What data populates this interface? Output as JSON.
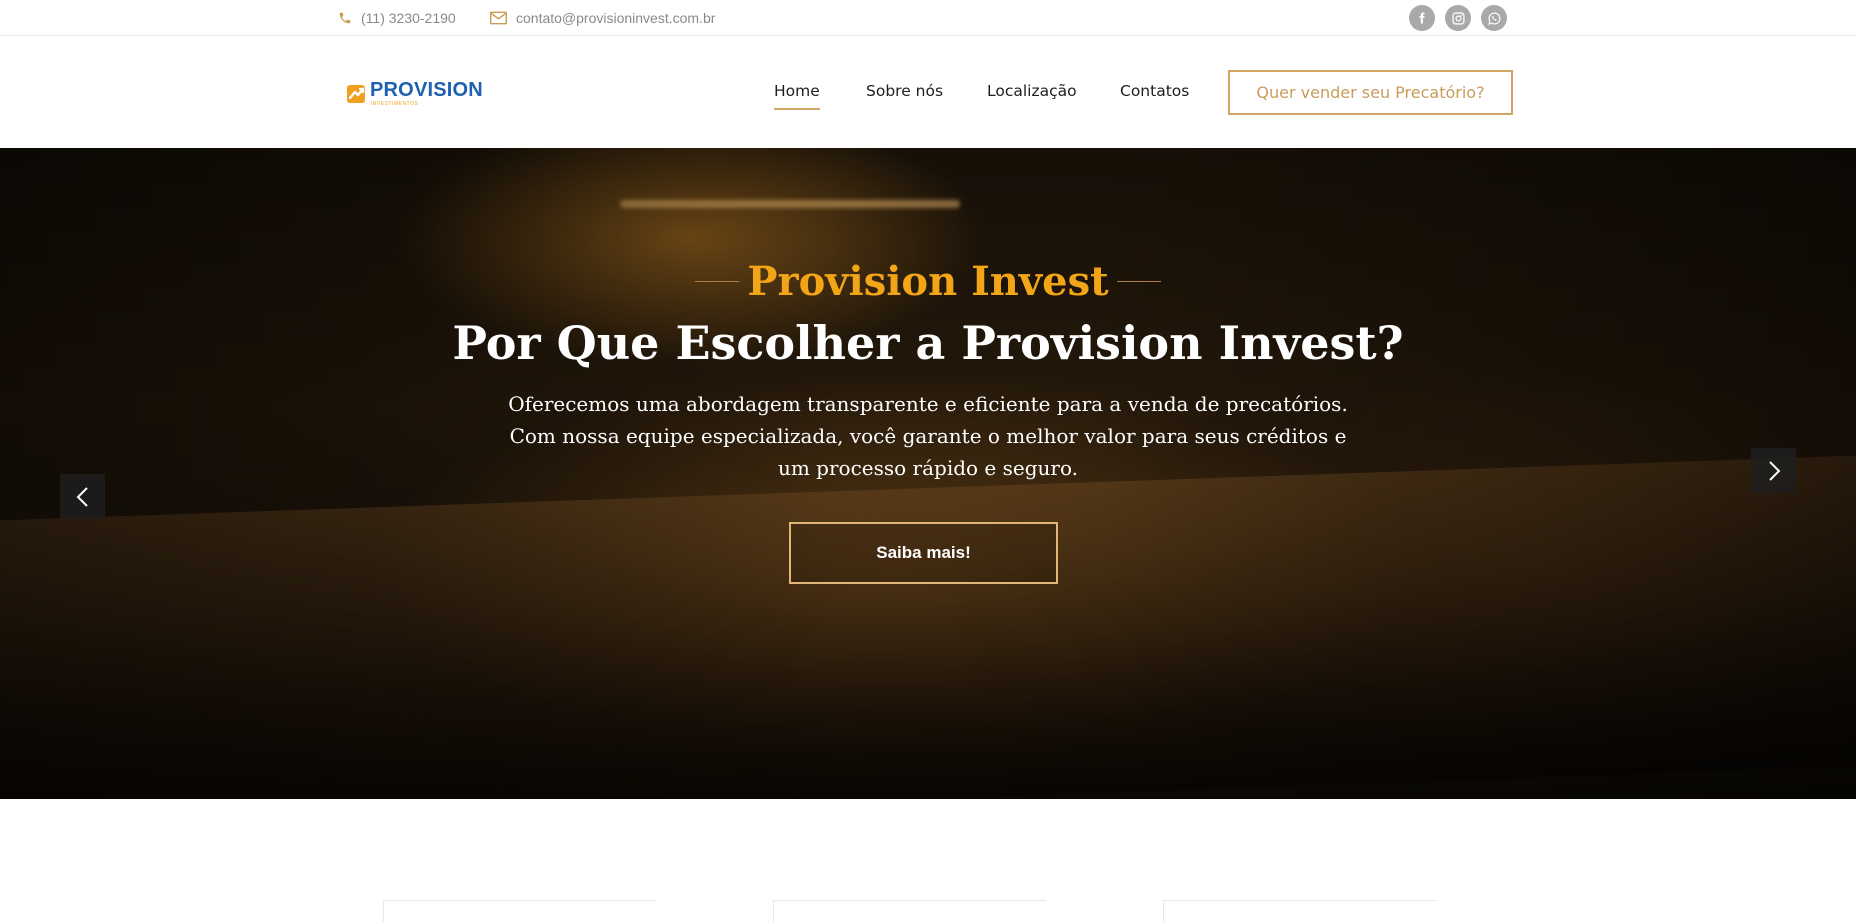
{
  "topbar": {
    "phone": "(11) 3230-2190",
    "email": "contato@provisioninvest.com.br",
    "social_icons": [
      "facebook-icon",
      "instagram-icon",
      "whatsapp-icon"
    ]
  },
  "header": {
    "logo_text": "PROVISION",
    "logo_subtext": "INVESTIMENTOS",
    "nav": [
      {
        "label": "Home",
        "active": true
      },
      {
        "label": "Sobre nós"
      },
      {
        "label": "Localização"
      },
      {
        "label": "Contatos"
      }
    ],
    "cta_label": "Quer vender seu Precatório?"
  },
  "hero": {
    "kicker": "Provision Invest",
    "title": "Por Que Escolher a Provision Invest?",
    "text": "Oferecemos uma abordagem transparente e eficiente para a venda de precatórios. Com nossa equipe especializada, você garante o melhor valor para seus créditos e um processo rápido e seguro.",
    "button_label": "Saiba mais!"
  },
  "colors": {
    "accent_gold": "#d2a564",
    "kicker_orange": "#f2a516",
    "brand_blue": "#2060b0"
  }
}
